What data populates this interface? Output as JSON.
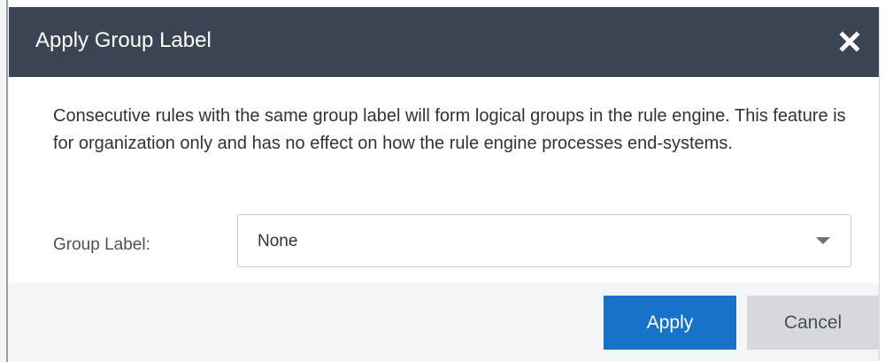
{
  "dialog": {
    "title": "Apply Group Label",
    "close_icon": "close-icon",
    "description": "Consecutive rules with the same group label will form logical groups in the rule engine. This feature is for organization only and has no effect on how the rule engine processes end-systems.",
    "group_label": {
      "label": "Group Label:",
      "selected_value": "None",
      "chevron_icon": "chevron-down-icon"
    },
    "buttons": {
      "apply_label": "Apply",
      "cancel_label": "Cancel"
    }
  },
  "colors": {
    "titlebar": "#3b4453",
    "primary_button": "#1673c9",
    "secondary_button": "#d6d8db",
    "footer": "#f4f5f6"
  }
}
